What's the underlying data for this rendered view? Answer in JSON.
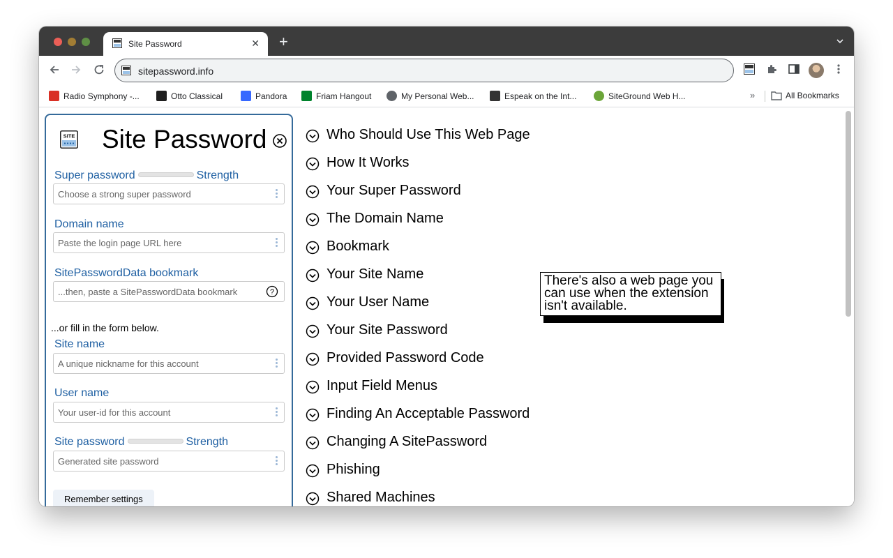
{
  "browser": {
    "tab_title": "Site Password",
    "url": "sitepassword.info",
    "bookmarks": [
      {
        "label": "Radio Symphony -...",
        "icon": "radio-symphony-icon",
        "color": "#d93025"
      },
      {
        "label": "Otto Classical",
        "icon": "otto-classical-icon",
        "color": "#1e1e1e"
      },
      {
        "label": "Pandora",
        "icon": "pandora-icon",
        "color": "#3668ff"
      },
      {
        "label": "Friam Hangout",
        "icon": "google-meet-icon",
        "color": "#00832d"
      },
      {
        "label": "My Personal Web...",
        "icon": "globe-icon",
        "color": "#5f6368"
      },
      {
        "label": "Espeak on the Int...",
        "icon": "archive-icon",
        "color": "#333333"
      },
      {
        "label": "SiteGround Web H...",
        "icon": "siteground-icon",
        "color": "#6ba539"
      }
    ],
    "all_bookmarks": "All Bookmarks"
  },
  "panel": {
    "title": "Site Password",
    "super_password": {
      "label": "Super password",
      "strength": "Strength",
      "placeholder": "Choose a strong super password"
    },
    "domain_name": {
      "label": "Domain name",
      "placeholder": "Paste the login page URL here"
    },
    "bookmark": {
      "label": "SitePasswordData bookmark",
      "placeholder": "...then, paste a SitePasswordData bookmark"
    },
    "or_text": "...or fill in the form below.",
    "site_name": {
      "label": "Site name",
      "placeholder": "A unique nickname for this account"
    },
    "user_name": {
      "label": "User name",
      "placeholder": "Your user-id for this account"
    },
    "site_password": {
      "label": "Site password",
      "strength": "Strength",
      "placeholder": "Generated site password"
    },
    "remember_button": "Remember settings"
  },
  "faq": [
    "Who Should Use This Web Page",
    "How It Works",
    "Your Super Password",
    "The Domain Name",
    "Bookmark",
    "Your Site Name",
    "Your User Name",
    "Your Site Password",
    "Provided Password Code",
    "Input Field Menus",
    "Finding An Acceptable Password",
    "Changing A SitePassword",
    "Phishing",
    "Shared Machines"
  ],
  "tooltip": "There's also a web page you can use when the extension isn't available.",
  "colors": {
    "accent": "#1e5fa2",
    "panel_border": "#356a9a"
  }
}
